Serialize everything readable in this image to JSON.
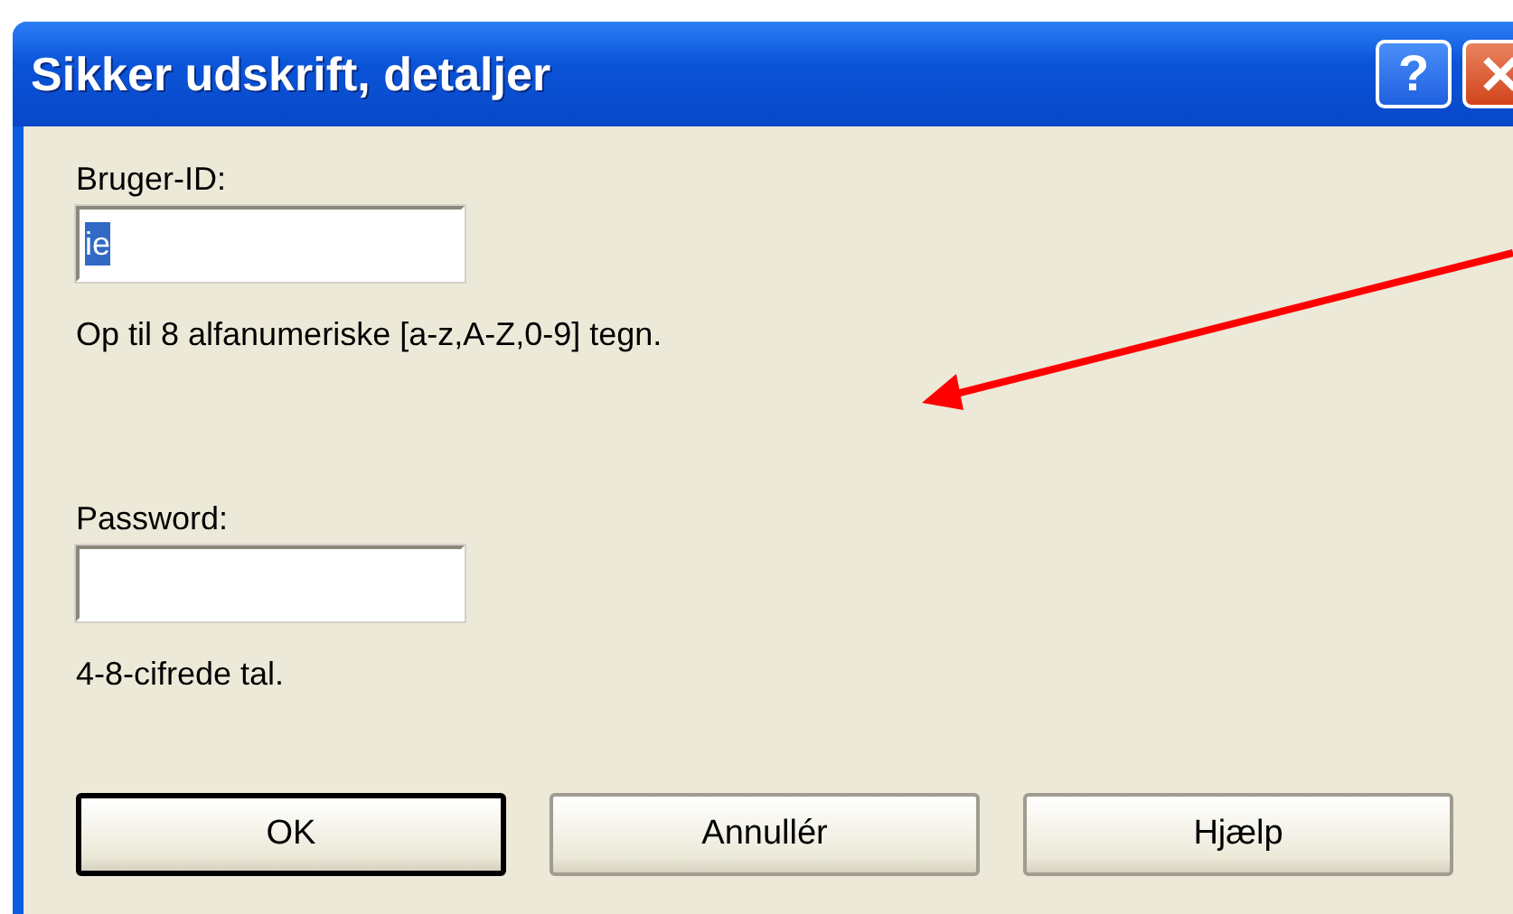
{
  "window": {
    "title": "Sikker udskrift, detaljer",
    "title_buttons": [
      {
        "kind": "help",
        "label": "?"
      },
      {
        "kind": "close"
      }
    ]
  },
  "fields": [
    {
      "label": "Bruger-ID:",
      "value": "ie",
      "text_selected": true,
      "hint": "Op til 8 alfanumeriske [a-z,A-Z,0-9] tegn."
    },
    {
      "label": "Password:",
      "hint": "4-8-cifrede tal."
    }
  ],
  "buttons": [
    {
      "label": "OK",
      "default": true
    },
    {
      "label": "Annullér",
      "default": false
    },
    {
      "label": "Hjælp",
      "default": false
    }
  ],
  "annotation": {
    "kind": "arrow"
  }
}
